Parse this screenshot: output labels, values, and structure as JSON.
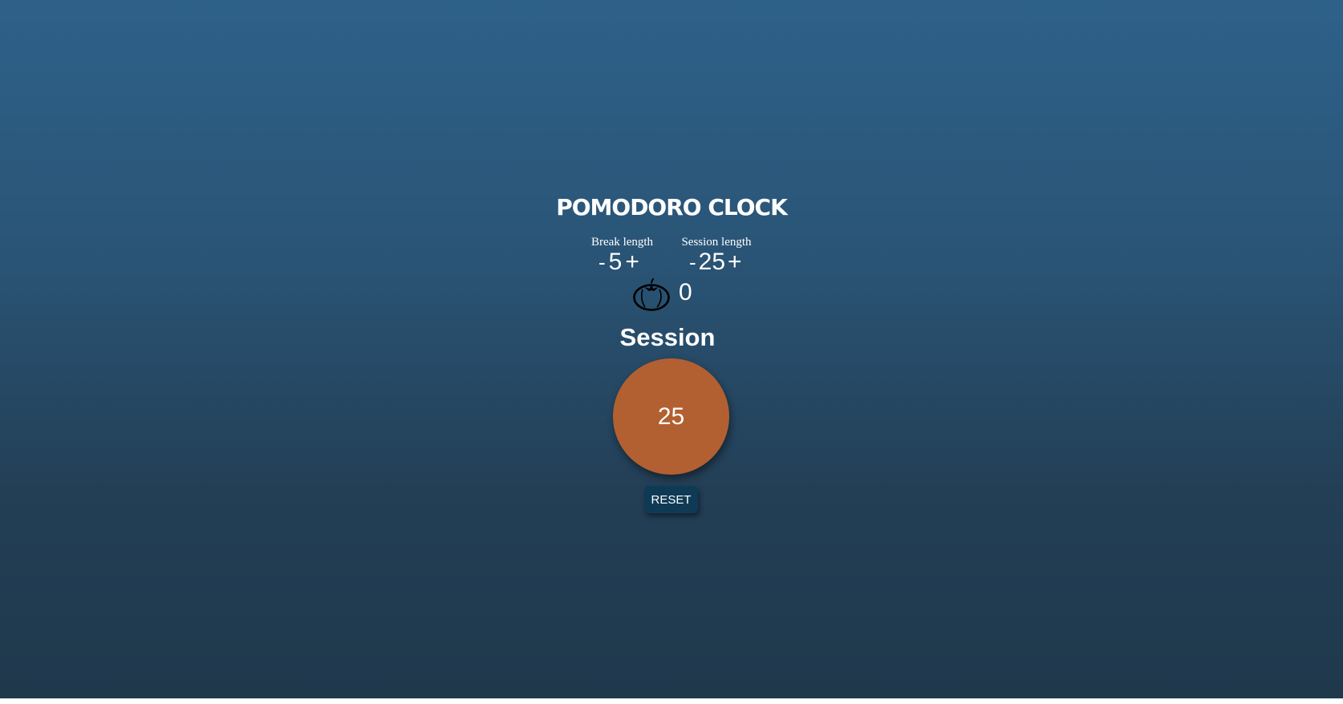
{
  "app": {
    "title": "POMODORO CLOCK"
  },
  "break_control": {
    "label": "Break length",
    "decrement_label": "-",
    "value": "5",
    "increment_label": "+"
  },
  "session_control": {
    "label": "Session length",
    "decrement_label": "-",
    "value": "25",
    "increment_label": "+"
  },
  "tomato_counter": {
    "icon": "tomato-icon",
    "count": "0"
  },
  "timer": {
    "mode_label": "Session",
    "display": "25"
  },
  "reset_button": {
    "label": "RESET"
  },
  "colors": {
    "background_top": "#2e6189",
    "background_bottom": "#1f384c",
    "timer_circle": "#b26031",
    "reset_button": "#0f3a55",
    "text": "#ffffff"
  }
}
